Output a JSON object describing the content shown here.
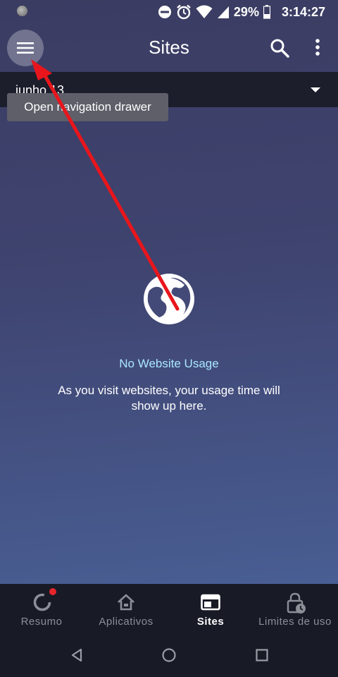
{
  "status_bar": {
    "battery": "29%",
    "time": "3:14:27"
  },
  "app_bar": {
    "title": "Sites",
    "menu_icon": "hamburger-menu-icon",
    "search_icon": "search-icon",
    "more_icon": "more-vert-icon"
  },
  "date_selector": {
    "value": "junho 13"
  },
  "tooltip": {
    "text": "Open navigation drawer"
  },
  "empty_state": {
    "icon": "globe-icon",
    "title": "No Website Usage",
    "description": "As you visit websites, your usage time will show up here."
  },
  "bottom_nav": {
    "items": [
      {
        "label": "Resumo",
        "icon": "dashboard-ring-icon",
        "active": false,
        "badge": true
      },
      {
        "label": "Aplicativos",
        "icon": "home-icon",
        "active": false,
        "badge": false
      },
      {
        "label": "Sites",
        "icon": "browser-window-icon",
        "active": true,
        "badge": false
      },
      {
        "label": "Limites de uso",
        "icon": "lock-clock-icon",
        "active": false,
        "badge": false
      }
    ]
  },
  "colors": {
    "accent_text": "#a9e7ff",
    "annotation_arrow": "#e8161c",
    "badge": "#e5262a"
  }
}
